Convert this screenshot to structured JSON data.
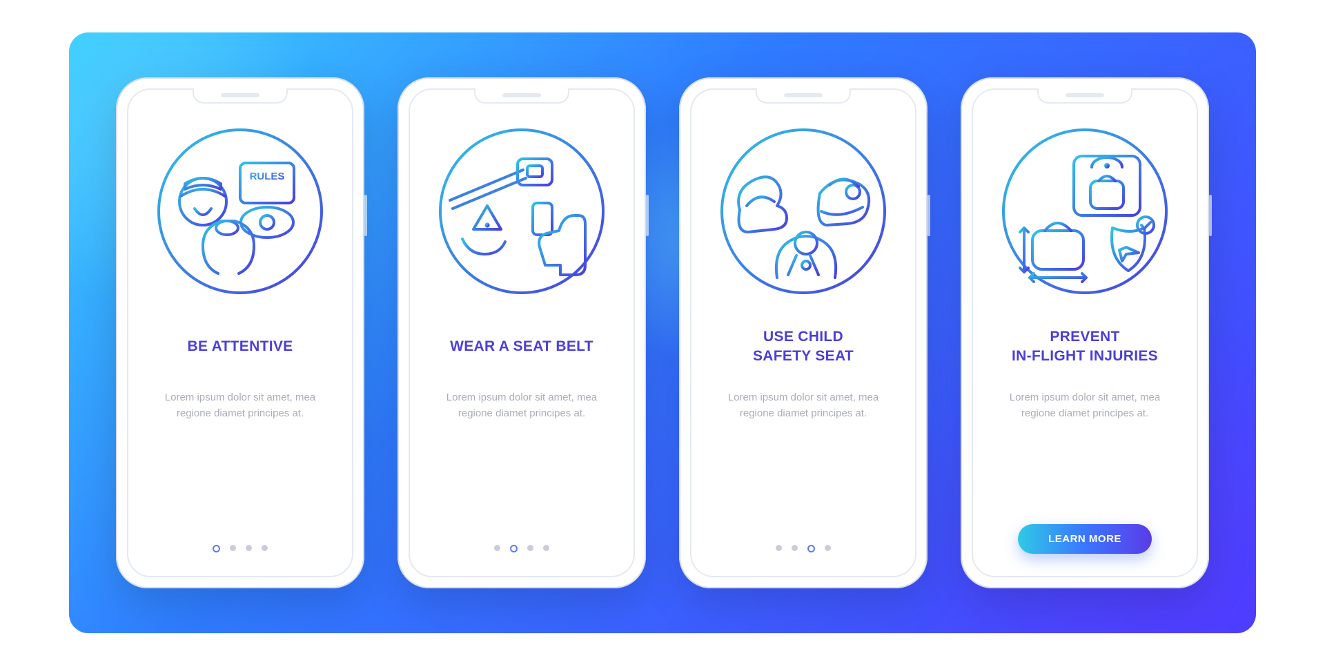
{
  "colors": {
    "title": "#4b3fd6",
    "desc": "#a9adb9",
    "dot_inactive": "#c9cdd8",
    "dot_active_border": "#5a7bff",
    "cta_gradient": [
      "#2fc9e6",
      "#3a77ff",
      "#5b3be6"
    ],
    "bg_gradient": [
      "#3bd0ff",
      "#2f7bff",
      "#4a3dff"
    ]
  },
  "screens": [
    {
      "icon_name": "be-attentive-icon",
      "title": "BE ATTENTIVE",
      "desc": "Lorem ipsum dolor sit amet, mea regione diamet principes at.",
      "page_count": 4,
      "active_dot_index": 0,
      "cta_label": null
    },
    {
      "icon_name": "seat-belt-icon",
      "title": "WEAR A SEAT BELT",
      "desc": "Lorem ipsum dolor sit amet, mea regione diamet principes at.",
      "page_count": 4,
      "active_dot_index": 1,
      "cta_label": null
    },
    {
      "icon_name": "child-safety-seat-icon",
      "title": "USE CHILD\nSAFETY SEAT",
      "desc": "Lorem ipsum dolor sit amet, mea regione diamet principes at.",
      "page_count": 4,
      "active_dot_index": 2,
      "cta_label": null
    },
    {
      "icon_name": "prevent-injuries-icon",
      "title": "PREVENT\nIN-FLIGHT INJURIES",
      "desc": "Lorem ipsum dolor sit amet, mea regione diamet principes at.",
      "page_count": 4,
      "active_dot_index": 3,
      "cta_label": "LEARN MORE"
    }
  ]
}
